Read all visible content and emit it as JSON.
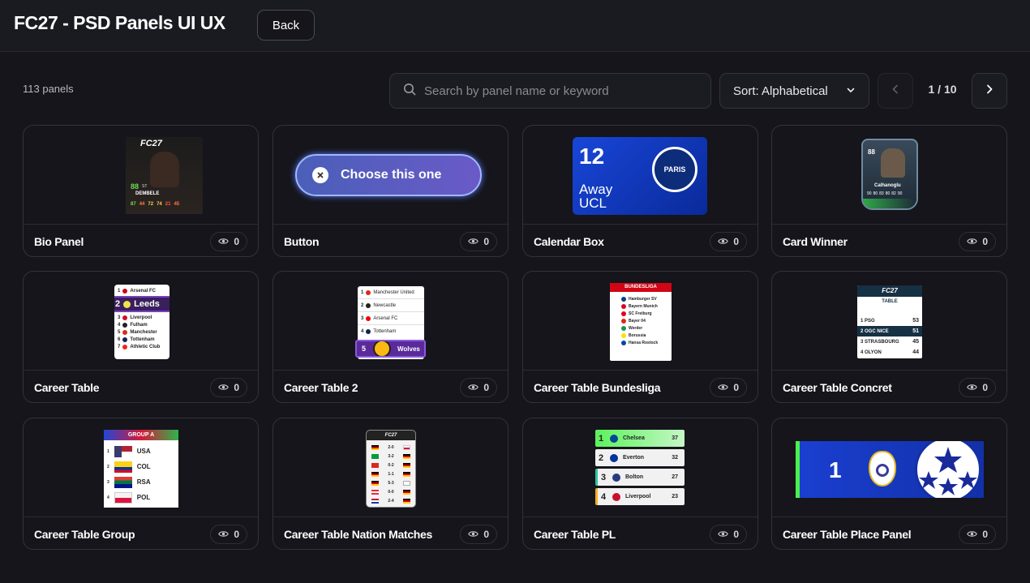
{
  "header": {
    "title": "FC27 - PSD Panels UI UX",
    "back_label": "Back"
  },
  "toolbar": {
    "count_label": "113 panels",
    "search_placeholder": "Search by panel name or keyword",
    "sort_label": "Sort: Alphabetical",
    "page_label": "1 / 10"
  },
  "cards": [
    {
      "name": "Bio Panel",
      "views": "0"
    },
    {
      "name": "Button",
      "views": "0"
    },
    {
      "name": "Calendar Box",
      "views": "0"
    },
    {
      "name": "Card Winner",
      "views": "0"
    },
    {
      "name": "Career Table",
      "views": "0"
    },
    {
      "name": "Career Table 2",
      "views": "0"
    },
    {
      "name": "Career Table Bundesliga",
      "views": "0"
    },
    {
      "name": "Career Table Concret",
      "views": "0"
    },
    {
      "name": "Career Table Group",
      "views": "0"
    },
    {
      "name": "Career Table Nation Matches",
      "views": "0"
    },
    {
      "name": "Career Table PL",
      "views": "0"
    },
    {
      "name": "Career Table Place Panel",
      "views": "0"
    }
  ],
  "previews": {
    "bio": {
      "brand": "FC27",
      "rating": "88",
      "position": "ST",
      "player": "DEMBELE",
      "stats": [
        "87",
        "44",
        "72",
        "74",
        "21",
        "45"
      ]
    },
    "button": {
      "label": "Choose this one"
    },
    "calendar": {
      "day": "12",
      "venue": "Away",
      "competition": "UCL",
      "club": "PARIS"
    },
    "card_winner": {
      "rating": "88",
      "player": "Calhanoglu",
      "stats": [
        "90",
        "80",
        "83",
        "80",
        "82",
        "90"
      ]
    },
    "career_table": {
      "rows": [
        "Arsenal FC",
        "Leeds",
        "Liverpool",
        "Fulham",
        "Manchester",
        "Tottenham",
        "Athletic Club"
      ],
      "nums": [
        "1",
        "2",
        "3",
        "4",
        "5",
        "6",
        "7"
      ]
    },
    "career_table_2": {
      "rows": [
        "Manchester United",
        "Newcastle",
        "Arsenal FC",
        "Tottenham",
        "Wolves"
      ],
      "nums": [
        "1",
        "2",
        "3",
        "4",
        "5"
      ]
    },
    "bundesliga": {
      "title": "BUNDESLIGA",
      "rows": [
        "Hamburger SV",
        "Bayern Munich",
        "SC Freiburg",
        "Bayer 04",
        "Werder",
        "Borussia",
        "Hansa Rostock"
      ]
    },
    "concret": {
      "brand": "FC27",
      "title": "TABLE",
      "rows": [
        "PSG",
        "OGC NICE",
        "STRASBOURG",
        "OLYON"
      ],
      "points": [
        "53",
        "51",
        "45",
        "44"
      ],
      "nums": [
        "1",
        "2",
        "3",
        "4"
      ]
    },
    "group": {
      "title": "GROUP A",
      "rows": [
        "USA",
        "COL",
        "RSA",
        "POL"
      ],
      "nums": [
        "1",
        "2",
        "3",
        "4"
      ]
    },
    "nation_matches": {
      "brand": "FC27",
      "scores": [
        "2-0",
        "3-2",
        "0-2",
        "1-1",
        "5-3",
        "0-0",
        "2-4"
      ]
    },
    "pl": {
      "rows": [
        "Chelsea",
        "Everton",
        "Bolton",
        "Liverpool"
      ],
      "points": [
        "37",
        "32",
        "27",
        "23"
      ],
      "nums": [
        "1",
        "2",
        "3",
        "4"
      ]
    },
    "place": {
      "position": "1"
    }
  }
}
